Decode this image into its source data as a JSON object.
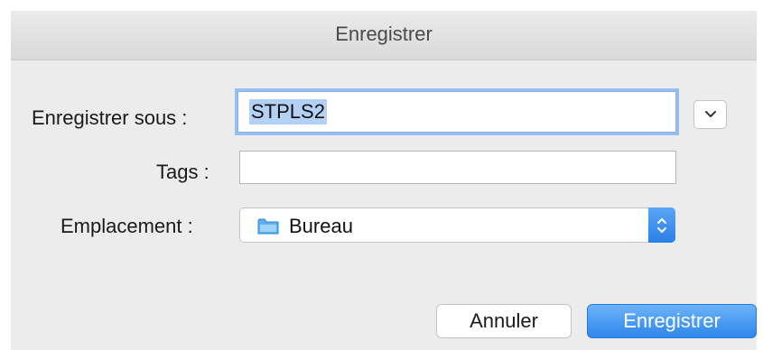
{
  "window": {
    "title": "Enregistrer"
  },
  "form": {
    "save_as_label": "Enregistrer sous :",
    "save_as_value": "STPLS2",
    "tags_label": "Tags :",
    "tags_value": "",
    "location_label": "Emplacement :",
    "location_value": "Bureau"
  },
  "buttons": {
    "cancel_label": "Annuler",
    "save_label": "Enregistrer"
  },
  "icons": {
    "expand": "chevron-down-icon",
    "folder": "folder-icon",
    "popup_arrows": "up-down-arrows-icon"
  },
  "colors": {
    "accent": "#2f86ec",
    "focus_ring": "#95bff0",
    "selection": "#b3d1f5",
    "folder": "#5ab0f0"
  }
}
